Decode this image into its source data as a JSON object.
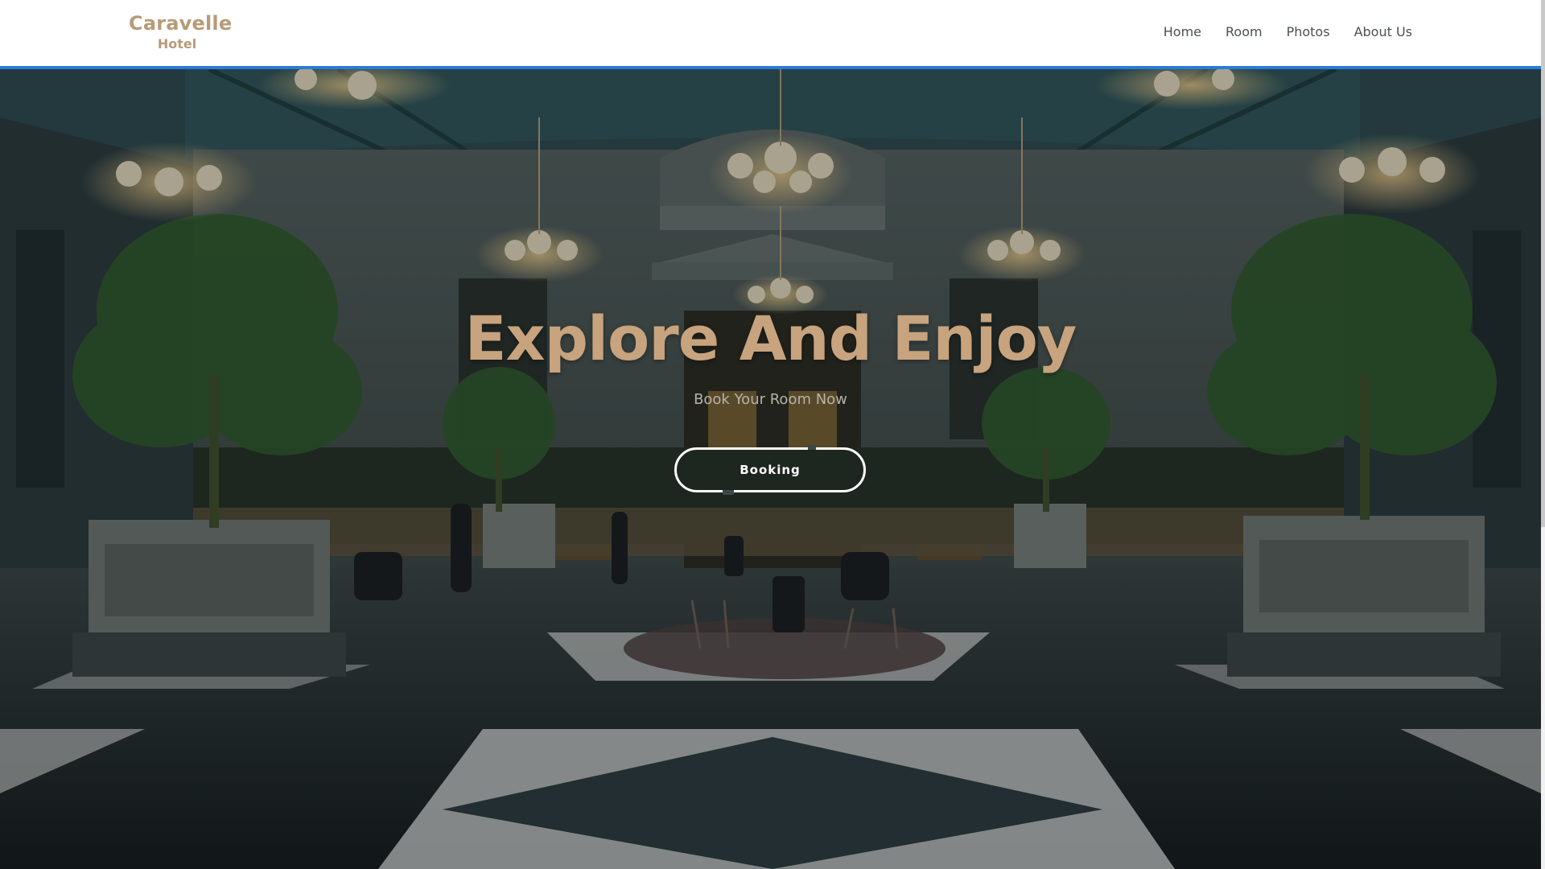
{
  "brand": {
    "name": "Caravelle",
    "sub": "Hotel",
    "color": "#b89a78"
  },
  "nav": {
    "items": [
      "Home",
      "Room",
      "Photos",
      "About Us"
    ]
  },
  "hero": {
    "title": "Explore And Enjoy",
    "subtitle": "Book Your Room Now",
    "button_label": "Booking",
    "title_color": "#c7a37e"
  },
  "colors": {
    "header_border": "#2a7bd8"
  }
}
